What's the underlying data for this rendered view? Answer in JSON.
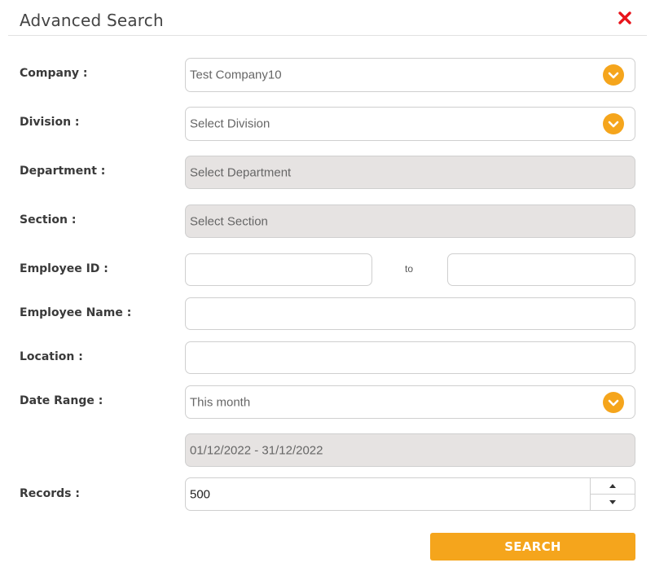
{
  "dialog": {
    "title": "Advanced Search",
    "close_icon": "close-x-icon",
    "accent_color": "#f5a51c",
    "close_color": "#e8141b"
  },
  "form": {
    "company": {
      "label": "Company :",
      "value": "Test Company10"
    },
    "division": {
      "label": "Division :",
      "placeholder": "Select Division"
    },
    "department": {
      "label": "Department :",
      "placeholder": "Select Department"
    },
    "section": {
      "label": "Section :",
      "placeholder": "Select Section"
    },
    "employee_id": {
      "label": "Employee ID :",
      "from_value": "",
      "separator": "to",
      "to_value": ""
    },
    "employee_name": {
      "label": "Employee Name :",
      "value": ""
    },
    "location": {
      "label": "Location :",
      "value": ""
    },
    "date_range": {
      "label": "Date Range :",
      "value": "This month",
      "range_text": "01/12/2022 - 31/12/2022"
    },
    "records": {
      "label": "Records :",
      "value": "500"
    }
  },
  "actions": {
    "search_label": "SEARCH"
  }
}
